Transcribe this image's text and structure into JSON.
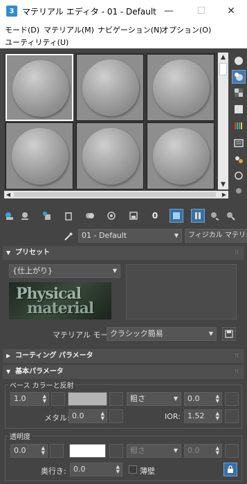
{
  "window": {
    "icon": "3",
    "title": "マテリアル エディタ - 01 - Default",
    "minimize": "—",
    "maximize": "☐",
    "close": "✕"
  },
  "menu": [
    "モード(D)",
    "マテリアル(M)",
    "ナビゲーション(N)",
    "オプション(O)",
    "ユーティリティ(U)"
  ],
  "icons": {
    "side": [
      "sphere-icon",
      "backlight-icon",
      "checker-background-icon",
      "uv-tiling-icon",
      "color-chart-icon",
      "options-icon",
      "select-by-material-icon",
      "material-map-navigator-icon",
      "view-map-icon"
    ],
    "bottom": [
      "get-material-icon",
      "put-to-scene-icon",
      "assign-to-selection-icon",
      "delete-icon",
      "copy-material-icon",
      "make-unique-icon",
      "put-to-library-icon",
      "material-id-icon",
      "show-map-icon",
      "show-end-result-icon",
      "go-to-parent-icon",
      "go-forward-sibling-icon"
    ]
  },
  "bottom_toolbar": {
    "material_id": "0"
  },
  "material": {
    "name": "01 - Default",
    "type": "フィジカル マテリアル"
  },
  "preset": {
    "header": "プリセット",
    "dropdown": "{仕上がり}",
    "image_line1": "Physical",
    "image_line2": "material",
    "mode_label": "マテリアル モード:",
    "mode_value": "クラシック簡易"
  },
  "coating": {
    "header": "コーティング パラメータ"
  },
  "basic": {
    "header": "基本パラメータ",
    "base_group": "ベース カラーと反射",
    "base_weight": "1.0",
    "base_color": "#b4b4b4",
    "roughness_mode": "粗さ",
    "roughness_value": "0.0",
    "metalness_label": "メタル:",
    "metalness_value": "0.0",
    "ior_label": "IOR:",
    "ior_value": "1.52",
    "trans_group": "透明度",
    "trans_weight": "0.0",
    "trans_color": "#ffffff",
    "trans_roughness_mode": "粗さ",
    "trans_roughness_value": "0.0",
    "depth_label": "奥行き:",
    "depth_value": "0.0",
    "thin_label": "薄壁"
  }
}
